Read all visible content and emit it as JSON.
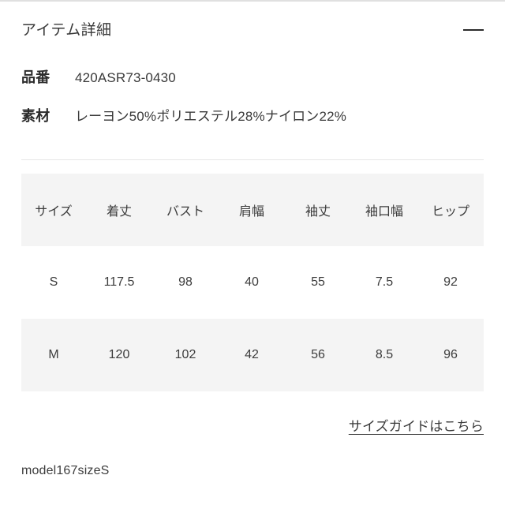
{
  "accordion": {
    "title": "アイテム詳細",
    "toggle_icon": "minus-icon",
    "expanded": true
  },
  "specs": [
    {
      "label": "品番",
      "value": "420ASR73-0430"
    },
    {
      "label": "素材",
      "value": "レーヨン50%ポリエステル28%ナイロン22%"
    }
  ],
  "size_table": {
    "headers": [
      "サイズ",
      "着丈",
      "バスト",
      "肩幅",
      "袖丈",
      "袖口幅",
      "ヒップ"
    ],
    "rows": [
      {
        "cells": [
          "S",
          "117.5",
          "98",
          "40",
          "55",
          "7.5",
          "92"
        ],
        "shaded": false
      },
      {
        "cells": [
          "M",
          "120",
          "102",
          "42",
          "56",
          "8.5",
          "96"
        ],
        "shaded": true
      }
    ],
    "header_shaded": true
  },
  "size_guide": {
    "label": "サイズガイドはこちら"
  },
  "model_note": "model167sizeS",
  "colors": {
    "background": "#ffffff",
    "text": "#3a3a3a",
    "shaded_row": "#f4f4f4",
    "divider": "#e6e6e6",
    "top_border": "#e0e0e0",
    "icon": "#2b2b2b"
  }
}
